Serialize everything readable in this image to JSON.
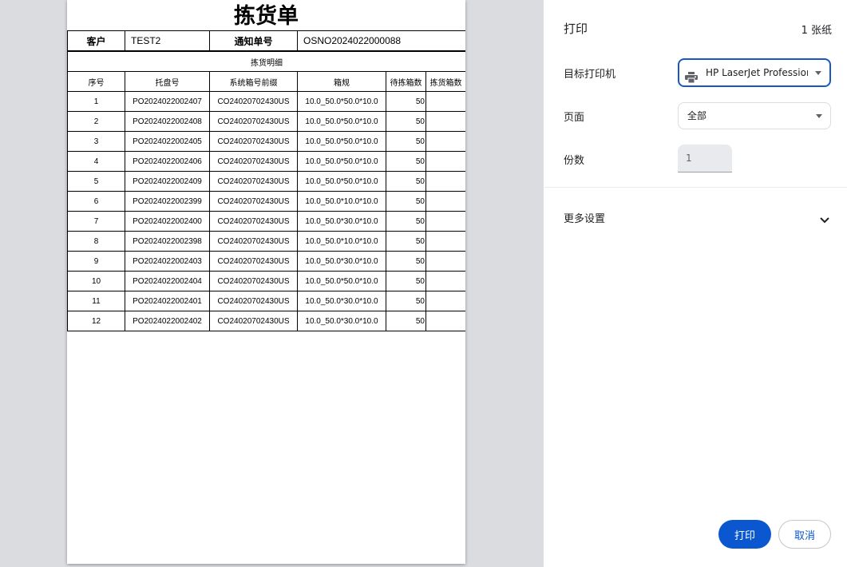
{
  "document": {
    "title": "拣货单",
    "customer_label": "客户",
    "customer_value": "TEST2",
    "notice_label": "通知单号",
    "notice_value": "OSNO2024022000088",
    "section_title": "拣货明细",
    "columns": [
      "序号",
      "托盘号",
      "系统箱号前缀",
      "箱规",
      "待拣箱数",
      "拣货箱数"
    ],
    "rows": [
      [
        "1",
        "PO2024022002407",
        "CO24020702430US",
        "10.0_50.0*50.0*10.0",
        "50",
        ""
      ],
      [
        "2",
        "PO2024022002408",
        "CO24020702430US",
        "10.0_50.0*50.0*10.0",
        "50",
        ""
      ],
      [
        "3",
        "PO2024022002405",
        "CO24020702430US",
        "10.0_50.0*50.0*10.0",
        "50",
        ""
      ],
      [
        "4",
        "PO2024022002406",
        "CO24020702430US",
        "10.0_50.0*50.0*10.0",
        "50",
        ""
      ],
      [
        "5",
        "PO2024022002409",
        "CO24020702430US",
        "10.0_50.0*50.0*10.0",
        "50",
        ""
      ],
      [
        "6",
        "PO2024022002399",
        "CO24020702430US",
        "10.0_50.0*10.0*10.0",
        "50",
        ""
      ],
      [
        "7",
        "PO2024022002400",
        "CO24020702430US",
        "10.0_50.0*30.0*10.0",
        "50",
        ""
      ],
      [
        "8",
        "PO2024022002398",
        "CO24020702430US",
        "10.0_50.0*10.0*10.0",
        "50",
        ""
      ],
      [
        "9",
        "PO2024022002403",
        "CO24020702430US",
        "10.0_50.0*30.0*10.0",
        "50",
        ""
      ],
      [
        "10",
        "PO2024022002404",
        "CO24020702430US",
        "10.0_50.0*50.0*10.0",
        "50",
        ""
      ],
      [
        "11",
        "PO2024022002401",
        "CO24020702430US",
        "10.0_50.0*30.0*10.0",
        "50",
        ""
      ],
      [
        "12",
        "PO2024022002402",
        "CO24020702430US",
        "10.0_50.0*30.0*10.0",
        "50",
        ""
      ]
    ]
  },
  "settings": {
    "title": "打印",
    "sheet_count": "1 张纸",
    "destination_label": "目标打印机",
    "destination_value": "HP LaserJet Professional",
    "pages_label": "页面",
    "pages_value": "全部",
    "copies_label": "份数",
    "copies_value": "1",
    "more_settings_label": "更多设置",
    "print_button": "打印",
    "cancel_button": "取消"
  },
  "icons": {
    "printer": "printer-icon",
    "caret": "caret-down-icon",
    "chevron": "chevron-down-icon"
  },
  "colors": {
    "accent": "#0b57d0",
    "focus_border": "#1a56c4",
    "preview_background": "#dadce0"
  }
}
